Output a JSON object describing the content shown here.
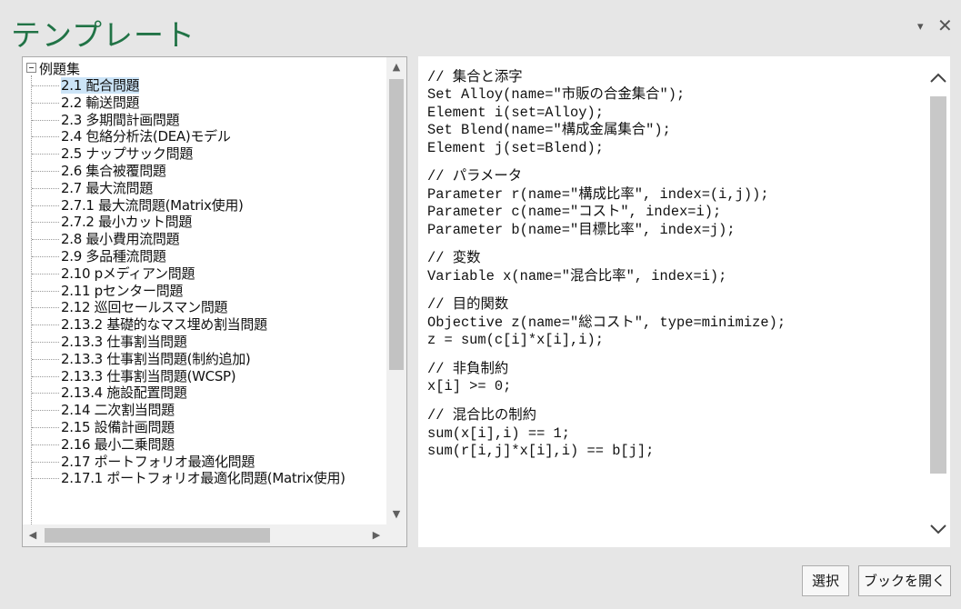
{
  "window": {
    "title": "テンプレート",
    "dropdown_glyph": "▾",
    "close_glyph": "✕"
  },
  "tree": {
    "root_label": "例題集",
    "items": [
      "2.1 配合問題",
      "2.2 輸送問題",
      "2.3 多期間計画問題",
      "2.4 包絡分析法(DEA)モデル",
      "2.5 ナップサック問題",
      "2.6 集合被覆問題",
      "2.7 最大流問題",
      "2.7.1 最大流問題(Matrix使用)",
      "2.7.2 最小カット問題",
      "2.8 最小費用流問題",
      "2.9 多品種流問題",
      "2.10 pメディアン問題",
      "2.11 pセンター問題",
      "2.12 巡回セールスマン問題",
      "2.13.2 基礎的なマス埋め割当問題",
      "2.13.3 仕事割当問題",
      "2.13.3 仕事割当問題(制約追加)",
      "2.13.3 仕事割当問題(WCSP)",
      "2.13.4 施設配置問題",
      "2.14 二次割当問題",
      "2.15 設備計画問題",
      "2.16 最小二乗問題",
      "2.17 ポートフォリオ最適化問題",
      "2.17.1 ポートフォリオ最適化問題(Matrix使用)"
    ],
    "selected_index": 0
  },
  "code": {
    "lines": [
      "// 集合と添字",
      "Set Alloy(name=\"市販の合金集合\");",
      "Element i(set=Alloy);",
      "Set Blend(name=\"構成金属集合\");",
      "Element j(set=Blend);",
      "",
      "// パラメータ",
      "Parameter r(name=\"構成比率\", index=(i,j));",
      "Parameter c(name=\"コスト\", index=i);",
      "Parameter b(name=\"目標比率\", index=j);",
      "",
      "// 変数",
      "Variable x(name=\"混合比率\", index=i);",
      "",
      "// 目的関数",
      "Objective z(name=\"総コスト\", type=minimize);",
      "z = sum(c[i]*x[i],i);",
      "",
      "// 非負制約",
      "x[i] >= 0;",
      "",
      "// 混合比の制約",
      "sum(x[i],i) == 1;",
      "sum(r[i,j]*x[i],i) == b[j];"
    ]
  },
  "buttons": {
    "select_label": "選択",
    "open_book_label": "ブックを開く"
  },
  "colors": {
    "title": "#217346",
    "selection": "#cce4f7"
  }
}
